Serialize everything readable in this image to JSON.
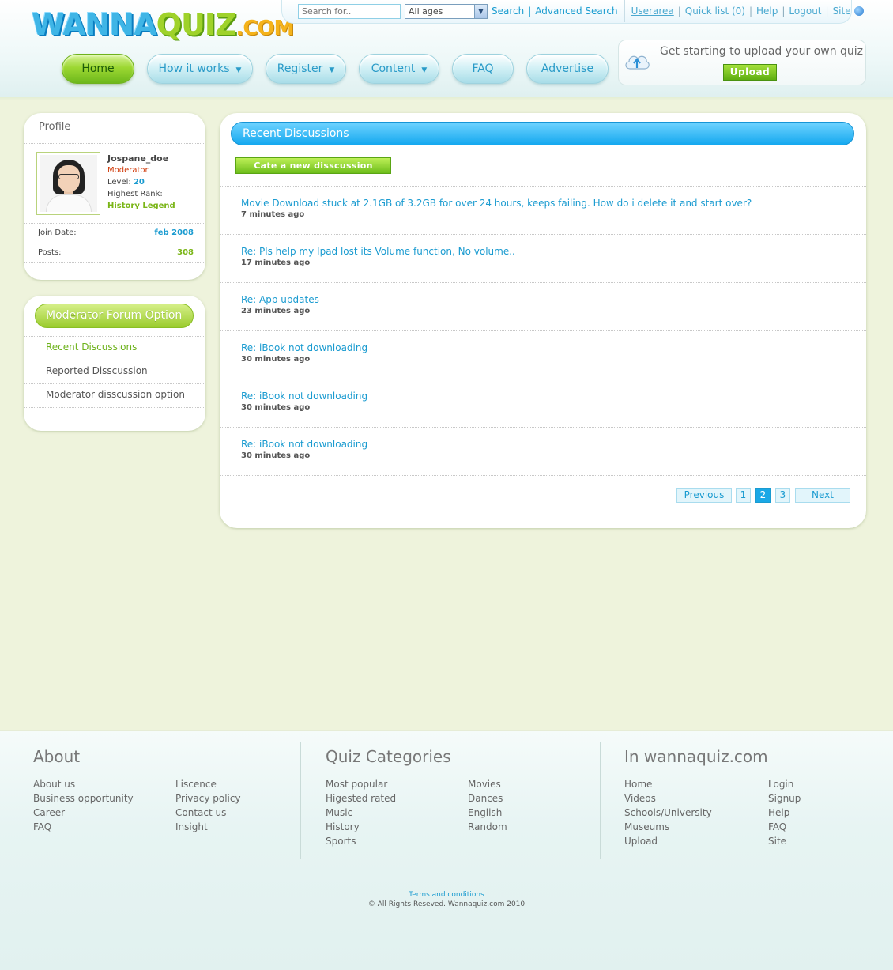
{
  "logo": {
    "part1": "WANNA",
    "part2": "QUIZ",
    "part3": ".COM"
  },
  "topbar": {
    "search_placeholder": "Search for..",
    "ages_value": "All ages",
    "search_label": "Search",
    "advanced_search_label": "Advanced Search",
    "userarea_label": "Userarea",
    "quicklist_label": "Quick list (0)",
    "help_label": "Help",
    "logout_label": "Logout",
    "site_label": "Site"
  },
  "nav": {
    "home": "Home",
    "how_it_works": "How it works",
    "register": "Register",
    "content": "Content",
    "faq": "FAQ",
    "advertise": "Advertise"
  },
  "upload": {
    "text": "Get starting to upload your own quiz",
    "button": "Upload"
  },
  "profile": {
    "title": "Profile",
    "username": "Jospane_doe",
    "role": "Moderator",
    "level_label": "Level:",
    "level_value": "20",
    "rank_label": "Highest Rank:",
    "rank_value": "History Legend",
    "join_label": "Join Date:",
    "join_value": "feb 2008",
    "posts_label": "Posts:",
    "posts_value": "308"
  },
  "moderator": {
    "title": "Moderator Forum Option",
    "items": [
      "Recent Discussions",
      "Reported Disscussion",
      "Moderator disscussion option"
    ]
  },
  "main": {
    "title": "Recent Discussions",
    "create_button": "Cate a new disscussion",
    "discussions": [
      {
        "title": "Movie Download stuck at 2.1GB of 3.2GB for over 24 hours, keeps failing.  How do i delete it and start over?",
        "time": "7 minutes ago"
      },
      {
        "title": "Re: Pls help my Ipad lost its Volume function, No volume..",
        "time": "17 minutes ago"
      },
      {
        "title": "Re: App updates",
        "time": "23 minutes ago"
      },
      {
        "title": "Re: iBook not downloading",
        "time": "30 minutes ago"
      },
      {
        "title": "Re: iBook not downloading",
        "time": "30 minutes ago"
      },
      {
        "title": "Re: iBook not downloading",
        "time": "30 minutes ago"
      }
    ],
    "pager": {
      "previous": "Previous",
      "pages": [
        "1",
        "2",
        "3"
      ],
      "current": "2",
      "next": "Next"
    }
  },
  "footer": {
    "about": {
      "title": "About",
      "col1": [
        "About us",
        "Business opportunity",
        "Career",
        "FAQ"
      ],
      "col2": [
        "Liscence",
        "Privacy policy",
        "Contact us",
        "Insight"
      ]
    },
    "categories": {
      "title": "Quiz Categories",
      "col1": [
        "Most popular",
        "Higested rated",
        "Music",
        "History",
        "Sports"
      ],
      "col2": [
        "Movies",
        "Dances",
        "English",
        "Random"
      ]
    },
    "inwanna": {
      "title": "In wannaquiz.com",
      "col1": [
        "Home",
        "Videos",
        "Schools/University",
        "Museums",
        "Upload"
      ],
      "col2": [
        "Login",
        "Signup",
        "Help",
        "FAQ",
        "Site"
      ]
    },
    "terms": "Terms and conditions",
    "copyright": "© All Rights Reseved. Wannaquiz.com 2010"
  }
}
